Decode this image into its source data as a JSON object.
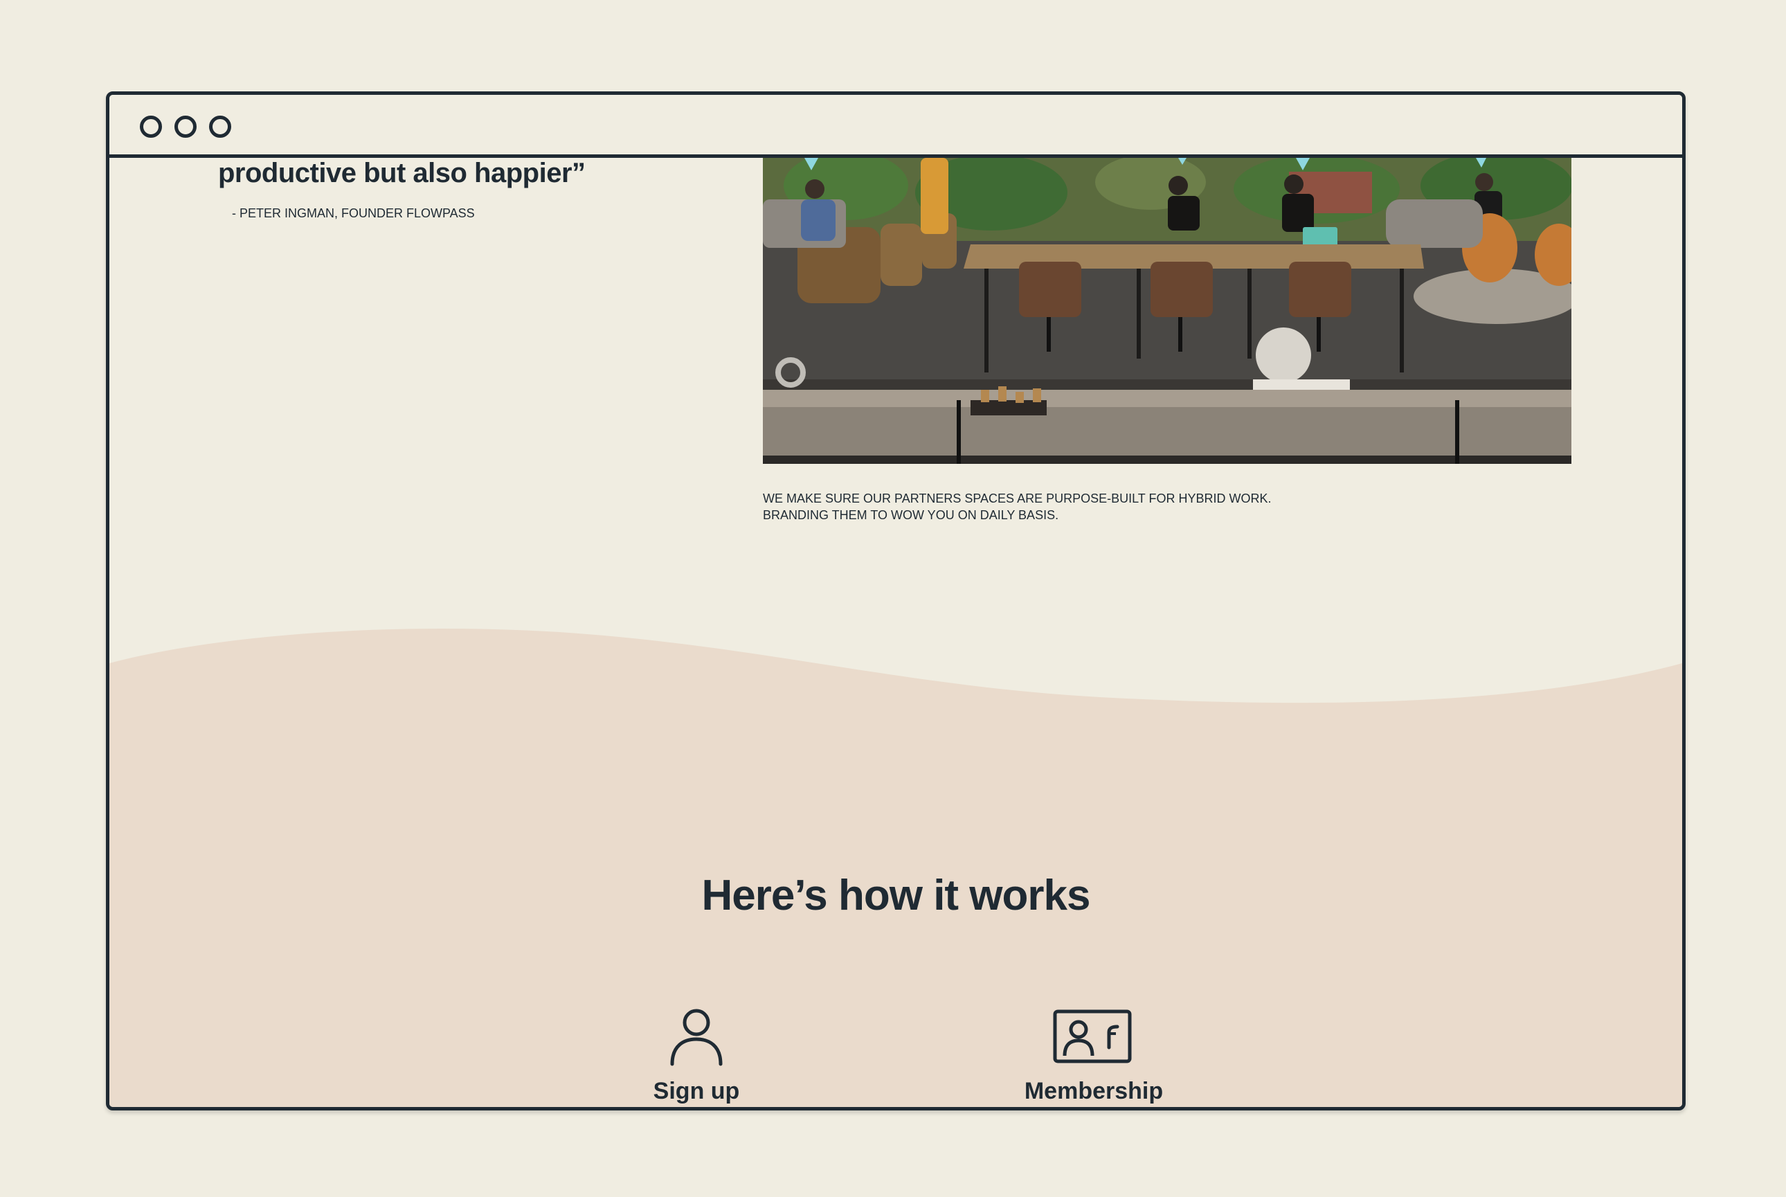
{
  "testimonial": {
    "quote_fragment": "productive but also happier”",
    "author": "- PETER INGMAN, FOUNDER FLOWPASS"
  },
  "photo": {
    "description_icon": "coworking-space-photo"
  },
  "caption": {
    "line1": "WE MAKE SURE OUR PARTNERS SPACES ARE PURPOSE-BUILT FOR HYBRID WORK.",
    "line2": "BRANDING THEM TO WOW YOU ON DAILY BASIS."
  },
  "how_it_works": {
    "title": "Here’s how it works",
    "steps": [
      {
        "label": "Sign up",
        "icon": "user-icon"
      },
      {
        "label": "Membership",
        "icon": "id-card-icon"
      }
    ]
  },
  "colors": {
    "background": "#f0ede1",
    "section_bg": "#eadbcc",
    "text": "#1f2a33",
    "accent": "#5fbfb0"
  }
}
